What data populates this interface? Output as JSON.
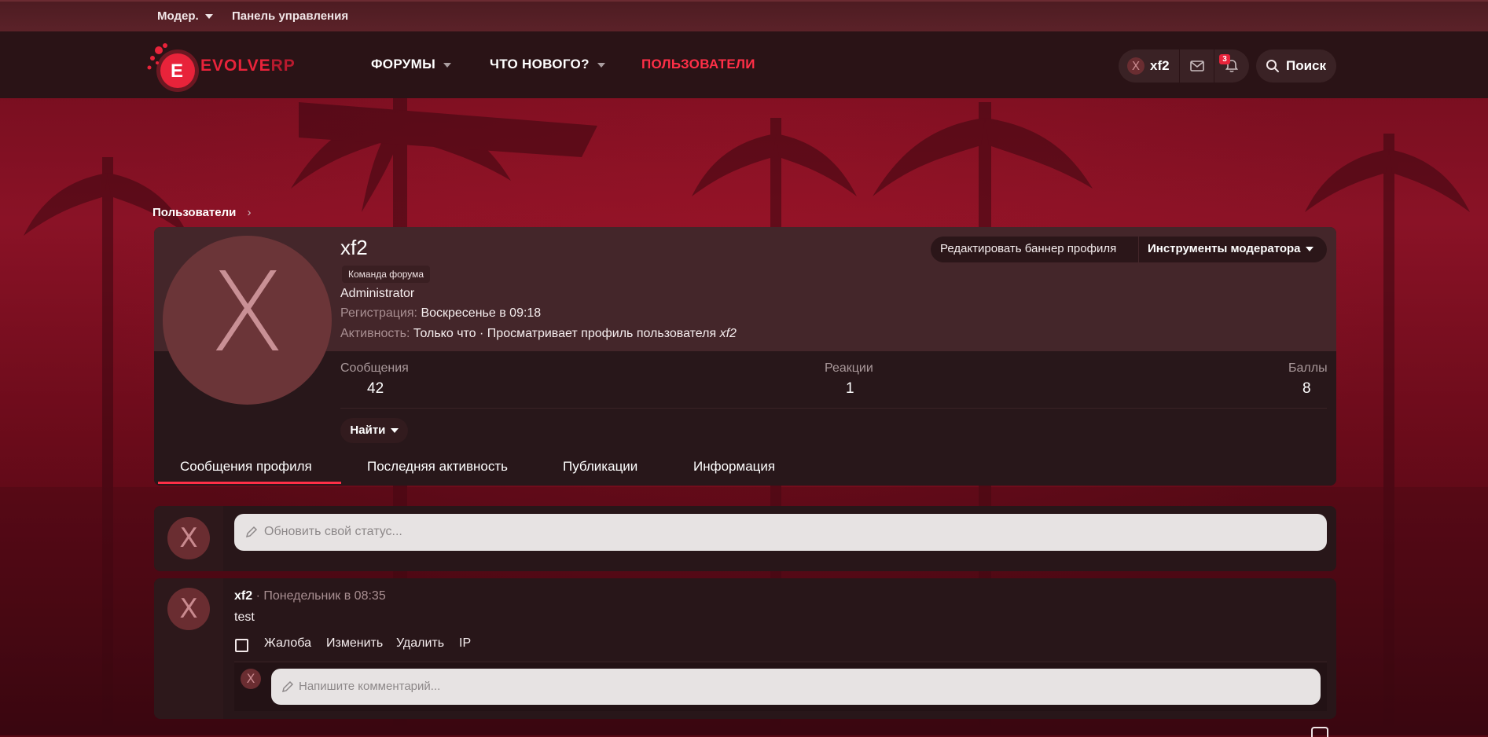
{
  "mod_bar": {
    "moderator_label": "Модер.",
    "control_panel_label": "Панель управления"
  },
  "logo": {
    "letter": "E",
    "name_main": "EVOLVE",
    "name_suffix": "RP"
  },
  "nav": {
    "forums": "ФОРУМЫ",
    "whats_new": "ЧТО НОВОГО?",
    "members": "ПОЛЬЗОВАТЕЛИ"
  },
  "account": {
    "avatar_letter": "X",
    "username": "xf2",
    "alerts_count": "3",
    "search_label": "Поиск"
  },
  "breadcrumb": {
    "members": "Пользователи"
  },
  "profile": {
    "avatar_letter": "X",
    "username": "xf2",
    "banner": "Команда форума",
    "user_title": "Administrator",
    "joined_label": "Регистрация:",
    "joined_value": "Воскресенье в 09:18",
    "last_seen_label": "Активность:",
    "last_seen_value": "Только что · Просматривает профиль пользователя",
    "last_seen_target": "xf2",
    "edit_banner_label": "Редактировать баннер профиля",
    "moderator_tools_label": "Инструменты модератора",
    "stats": [
      {
        "label": "Сообщения",
        "value": "42"
      },
      {
        "label": "Реакции",
        "value": "1"
      },
      {
        "label": "Баллы",
        "value": "8"
      }
    ],
    "find_label": "Найти",
    "tabs": [
      "Сообщения профиля",
      "Последняя активность",
      "Публикации",
      "Информация"
    ]
  },
  "status_update": {
    "avatar_letter": "X",
    "placeholder": "Обновить свой статус..."
  },
  "post": {
    "avatar_letter": "X",
    "author": "xf2",
    "date": "· Понедельник в 08:35",
    "body": "test",
    "actions": [
      "Жалоба",
      "Изменить",
      "Удалить",
      "IP"
    ],
    "comment_avatar_letter": "X",
    "comment_placeholder": "Напишите комментарий..."
  },
  "colors": {
    "accent": "#ff2f47",
    "header_bg": "#2a1316",
    "card_top": "#44262a",
    "avatar_bg": "#6b3538"
  }
}
